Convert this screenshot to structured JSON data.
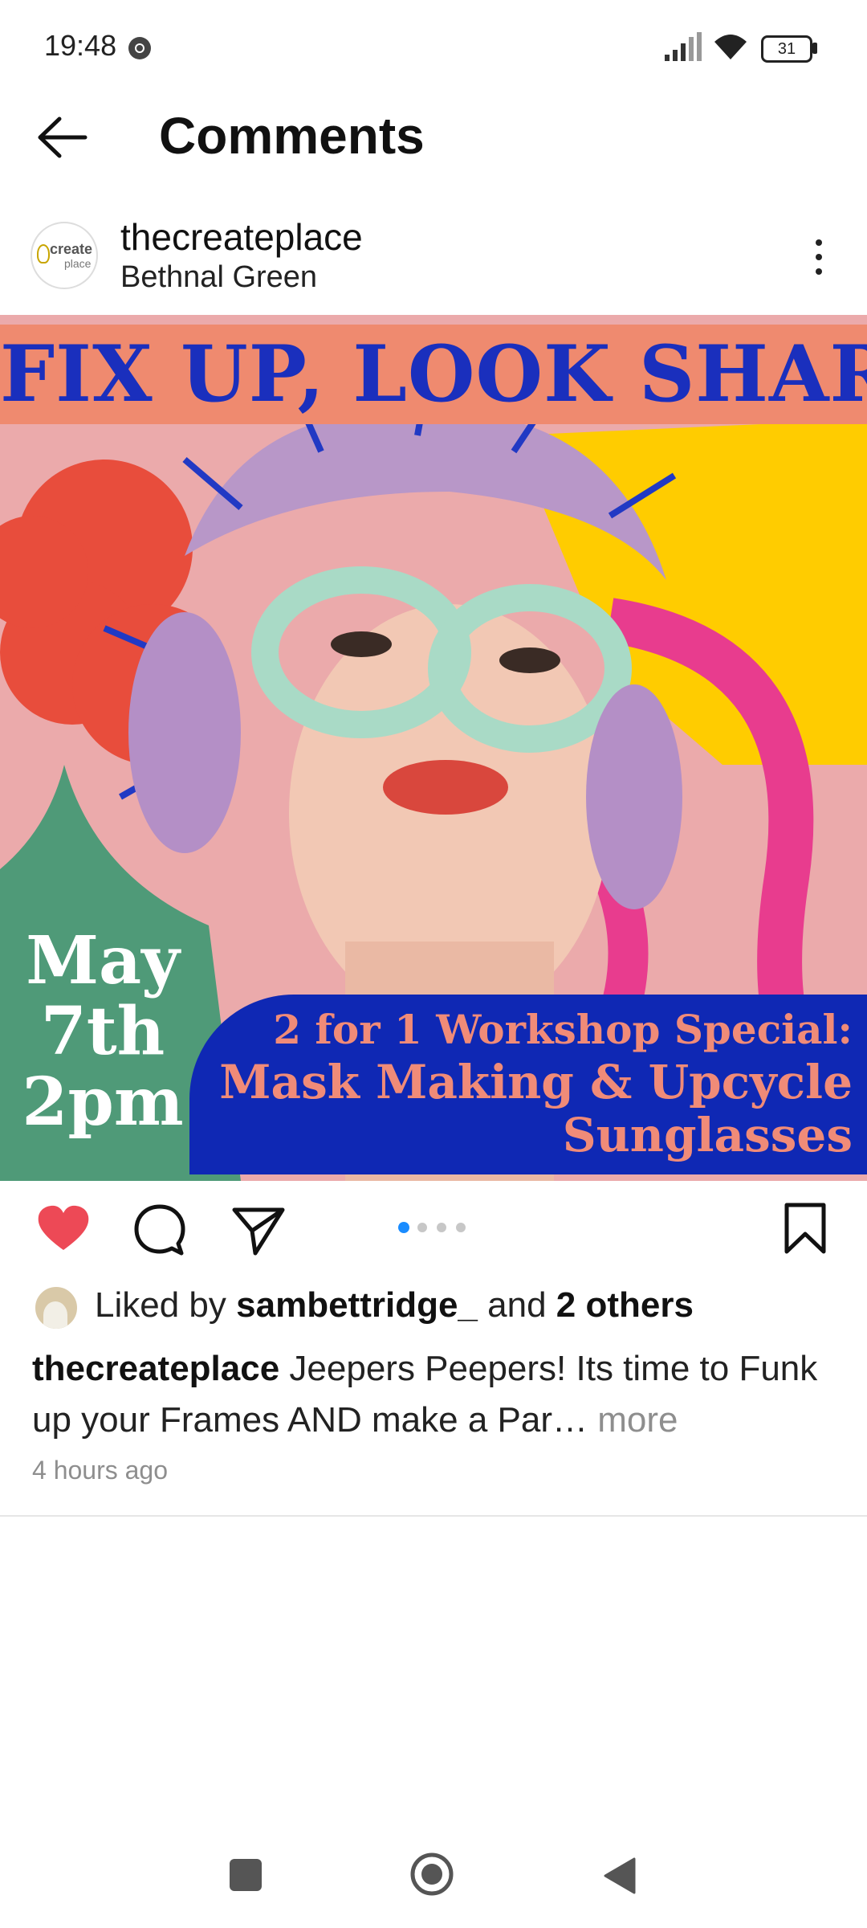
{
  "status_bar": {
    "time": "19:48",
    "battery": "31"
  },
  "header": {
    "title": "Comments"
  },
  "post": {
    "username": "thecreateplace",
    "location": "Bethnal Green",
    "avatar_text_top": "create",
    "avatar_text_bottom": "place",
    "image": {
      "banner": "FIX UP, LOOK SHARP!",
      "date_lines": [
        "May",
        "7th",
        "2pm"
      ],
      "promo_line1": "2 for 1 Workshop Special:",
      "promo_line2": "Mask Making & Upcycle",
      "promo_line3": "Sunglasses"
    },
    "carousel": {
      "count": 4,
      "active_index": 0
    },
    "liked": {
      "prefix": "Liked by",
      "user": "sambettridge_",
      "joiner": "and",
      "others": "2 others"
    },
    "caption": {
      "username": "thecreateplace",
      "text": "Jeepers Peepers! Its time to Funk up your Frames AND make a Par…",
      "more": "more"
    },
    "time_ago": "4 hours ago"
  },
  "colors": {
    "accent_blue": "#1a8cff",
    "heart_red": "#ed4956",
    "banner_orange": "#ef8a6f",
    "banner_blue": "#1a2fbd",
    "panel_blue": "#0f28b4"
  }
}
